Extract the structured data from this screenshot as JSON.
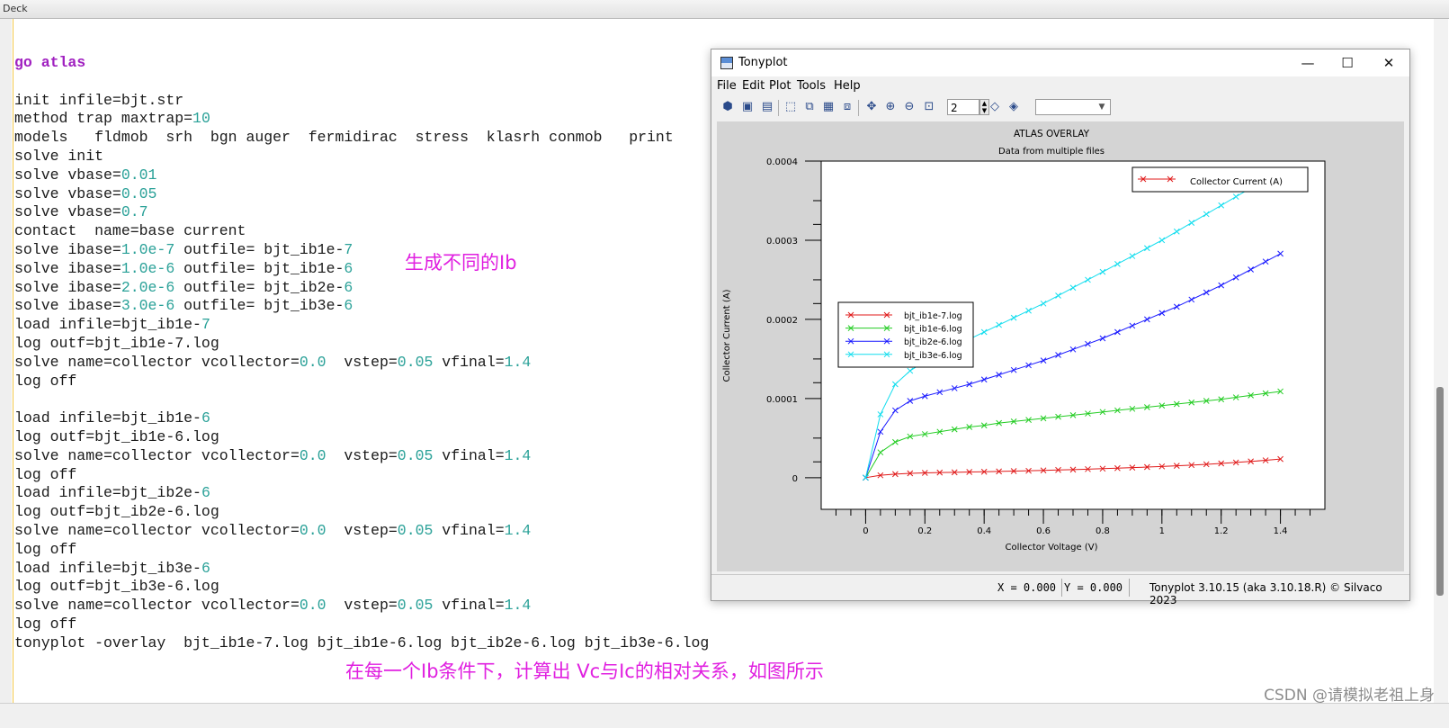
{
  "deck": {
    "title": "Deck",
    "code_lines": [
      [
        {
          "t": "go atlas",
          "c": "kw"
        }
      ],
      [],
      [
        {
          "t": "init infile=bjt.str"
        }
      ],
      [
        {
          "t": "method trap maxtrap="
        },
        {
          "t": "10",
          "c": "num"
        }
      ],
      [
        {
          "t": "models   fldmob  srh  bgn auger  fermidirac  stress  klasrh conmob   print"
        }
      ],
      [
        {
          "t": "solve init"
        }
      ],
      [
        {
          "t": "solve vbase="
        },
        {
          "t": "0.01",
          "c": "num"
        }
      ],
      [
        {
          "t": "solve vbase="
        },
        {
          "t": "0.05",
          "c": "num"
        }
      ],
      [
        {
          "t": "solve vbase="
        },
        {
          "t": "0.7",
          "c": "num"
        }
      ],
      [
        {
          "t": "contact  name=base current"
        }
      ],
      [
        {
          "t": "solve ibase="
        },
        {
          "t": "1.0e-7",
          "c": "num"
        },
        {
          "t": " outfile= bjt_ib1e-"
        },
        {
          "t": "7",
          "c": "num"
        }
      ],
      [
        {
          "t": "solve ibase="
        },
        {
          "t": "1.0e-6",
          "c": "num"
        },
        {
          "t": " outfile= bjt_ib1e-"
        },
        {
          "t": "6",
          "c": "num"
        }
      ],
      [
        {
          "t": "solve ibase="
        },
        {
          "t": "2.0e-6",
          "c": "num"
        },
        {
          "t": " outfile= bjt_ib2e-"
        },
        {
          "t": "6",
          "c": "num"
        }
      ],
      [
        {
          "t": "solve ibase="
        },
        {
          "t": "3.0e-6",
          "c": "num"
        },
        {
          "t": " outfile= bjt_ib3e-"
        },
        {
          "t": "6",
          "c": "num"
        }
      ],
      [
        {
          "t": "load infile=bjt_ib1e-"
        },
        {
          "t": "7",
          "c": "num"
        }
      ],
      [
        {
          "t": "log outf=bjt_ib1e-7.log"
        }
      ],
      [
        {
          "t": "solve name=collector vcollector="
        },
        {
          "t": "0.0",
          "c": "num"
        },
        {
          "t": "  vstep="
        },
        {
          "t": "0.05",
          "c": "num"
        },
        {
          "t": " vfinal="
        },
        {
          "t": "1.4",
          "c": "num"
        }
      ],
      [
        {
          "t": "log off"
        }
      ],
      [],
      [
        {
          "t": "load infile=bjt_ib1e-"
        },
        {
          "t": "6",
          "c": "num"
        }
      ],
      [
        {
          "t": "log outf=bjt_ib1e-6.log"
        }
      ],
      [
        {
          "t": "solve name=collector vcollector="
        },
        {
          "t": "0.0",
          "c": "num"
        },
        {
          "t": "  vstep="
        },
        {
          "t": "0.05",
          "c": "num"
        },
        {
          "t": " vfinal="
        },
        {
          "t": "1.4",
          "c": "num"
        }
      ],
      [
        {
          "t": "log off"
        }
      ],
      [
        {
          "t": "load infile=bjt_ib2e-"
        },
        {
          "t": "6",
          "c": "num"
        }
      ],
      [
        {
          "t": "log outf=bjt_ib2e-6.log"
        }
      ],
      [
        {
          "t": "solve name=collector vcollector="
        },
        {
          "t": "0.0",
          "c": "num"
        },
        {
          "t": "  vstep="
        },
        {
          "t": "0.05",
          "c": "num"
        },
        {
          "t": " vfinal="
        },
        {
          "t": "1.4",
          "c": "num"
        }
      ],
      [
        {
          "t": "log off"
        }
      ],
      [
        {
          "t": "load infile=bjt_ib3e-"
        },
        {
          "t": "6",
          "c": "num"
        }
      ],
      [
        {
          "t": "log outf=bjt_ib3e-6.log"
        }
      ],
      [
        {
          "t": "solve name=collector vcollector="
        },
        {
          "t": "0.0",
          "c": "num"
        },
        {
          "t": "  vstep="
        },
        {
          "t": "0.05",
          "c": "num"
        },
        {
          "t": " vfinal="
        },
        {
          "t": "1.4",
          "c": "num"
        }
      ],
      [
        {
          "t": "log off"
        }
      ],
      [
        {
          "t": "tonyplot -overlay  bjt_ib1e-7.log bjt_ib1e-6.log bjt_ib2e-6.log bjt_ib3e-6.log"
        }
      ]
    ],
    "annotation_1": "生成不同的Ib",
    "annotation_2": "在每一个Ib条件下，计算出  Vc与Ic的相对关系，如图所示",
    "watermark": "CSDN @请模拟老祖上身"
  },
  "tonyplot": {
    "window_title": "Tonyplot",
    "controls": {
      "minimize": "—",
      "maximize": "☐",
      "close": "✕"
    },
    "menu": [
      "File",
      "Edit",
      "Plot",
      "Tools",
      "Help"
    ],
    "zoom_value": "2",
    "status": {
      "x_readout": "X = 0.000",
      "y_readout": "Y = 0.000",
      "version": "Tonyplot 3.10.15 (aka 3.10.18.R) © Silvaco 2023"
    }
  },
  "colors": {
    "keyword": "#a020c0",
    "number": "#2aa198",
    "annotation": "#e020e0",
    "collector": "#e01a1a",
    "ib1e7": "#e01a1a",
    "ib1e6": "#22cc22",
    "ib2e6": "#1a1aff",
    "ib3e6": "#11ddee"
  },
  "chart_data": {
    "type": "line",
    "title": "ATLAS OVERLAY",
    "subtitle": "Data from multiple files",
    "xlabel": "Collector Voltage (V)",
    "ylabel": "Collector Current (A)",
    "xlim": [
      -0.15,
      1.55
    ],
    "ylim": [
      -4e-05,
      0.0004
    ],
    "xticks": [
      "0",
      "0.2",
      "0.4",
      "0.6",
      "0.8",
      "1",
      "1.2",
      "1.4"
    ],
    "yticks": [
      "0",
      "0.0001",
      "0.0002",
      "0.0003",
      "0.0004"
    ],
    "x": [
      0,
      0.05,
      0.1,
      0.15,
      0.2,
      0.25,
      0.3,
      0.35,
      0.4,
      0.45,
      0.5,
      0.55,
      0.6,
      0.65,
      0.7,
      0.75,
      0.8,
      0.85,
      0.9,
      0.95,
      1.0,
      1.05,
      1.1,
      1.15,
      1.2,
      1.25,
      1.3,
      1.35,
      1.4
    ],
    "marker": "x",
    "series": [
      {
        "name": "bjt_ib1e-7.log",
        "values": [
          0,
          3e-06,
          4.5e-06,
          5.5e-06,
          6e-06,
          6.5e-06,
          6.8e-06,
          7.2e-06,
          7.5e-06,
          7.9e-06,
          8.3e-06,
          8.7e-06,
          9.2e-06,
          9.7e-06,
          1.02e-05,
          1.08e-05,
          1.14e-05,
          1.2e-05,
          1.27e-05,
          1.34e-05,
          1.42e-05,
          1.5e-05,
          1.59e-05,
          1.69e-05,
          1.8e-05,
          1.92e-05,
          2.05e-05,
          2.19e-05,
          2.35e-05
        ]
      },
      {
        "name": "bjt_ib1e-6.log",
        "values": [
          0,
          3.2e-05,
          4.5e-05,
          5.2e-05,
          5.5e-05,
          5.8e-05,
          6.1e-05,
          6.4e-05,
          6.6e-05,
          6.9e-05,
          7.1e-05,
          7.3e-05,
          7.5e-05,
          7.7e-05,
          7.9e-05,
          8.1e-05,
          8.3e-05,
          8.5e-05,
          8.7e-05,
          8.9e-05,
          9.1e-05,
          9.3e-05,
          9.5e-05,
          9.7e-05,
          9.9e-05,
          0.0001015,
          0.000104,
          0.0001065,
          0.000109
        ]
      },
      {
        "name": "bjt_ib2e-6.log",
        "values": [
          0,
          5.8e-05,
          8.5e-05,
          9.7e-05,
          0.000103,
          0.000108,
          0.000113,
          0.000118,
          0.000124,
          0.00013,
          0.000136,
          0.000142,
          0.000148,
          0.000155,
          0.000162,
          0.000169,
          0.000176,
          0.000184,
          0.000192,
          0.0002,
          0.000208,
          0.000216,
          0.000225,
          0.000234,
          0.000243,
          0.000253,
          0.000263,
          0.000273,
          0.000283
        ]
      },
      {
        "name": "bjt_ib3e-6.log",
        "values": [
          0,
          8e-05,
          0.000118,
          0.000135,
          0.000147,
          0.000157,
          0.000166,
          0.000175,
          0.000184,
          0.000193,
          0.000202,
          0.000211,
          0.00022,
          0.00023,
          0.00024,
          0.00025,
          0.00026,
          0.00027,
          0.00028,
          0.00029,
          0.0003,
          0.000311,
          0.000322,
          0.000333,
          0.000344,
          0.000355,
          0.000366,
          0.000377,
          0.000388
        ]
      }
    ],
    "legend_top": {
      "name": "Collector Current (A)",
      "placement": "top-right"
    },
    "legend_files_placement": "left-middle",
    "grid": false
  }
}
